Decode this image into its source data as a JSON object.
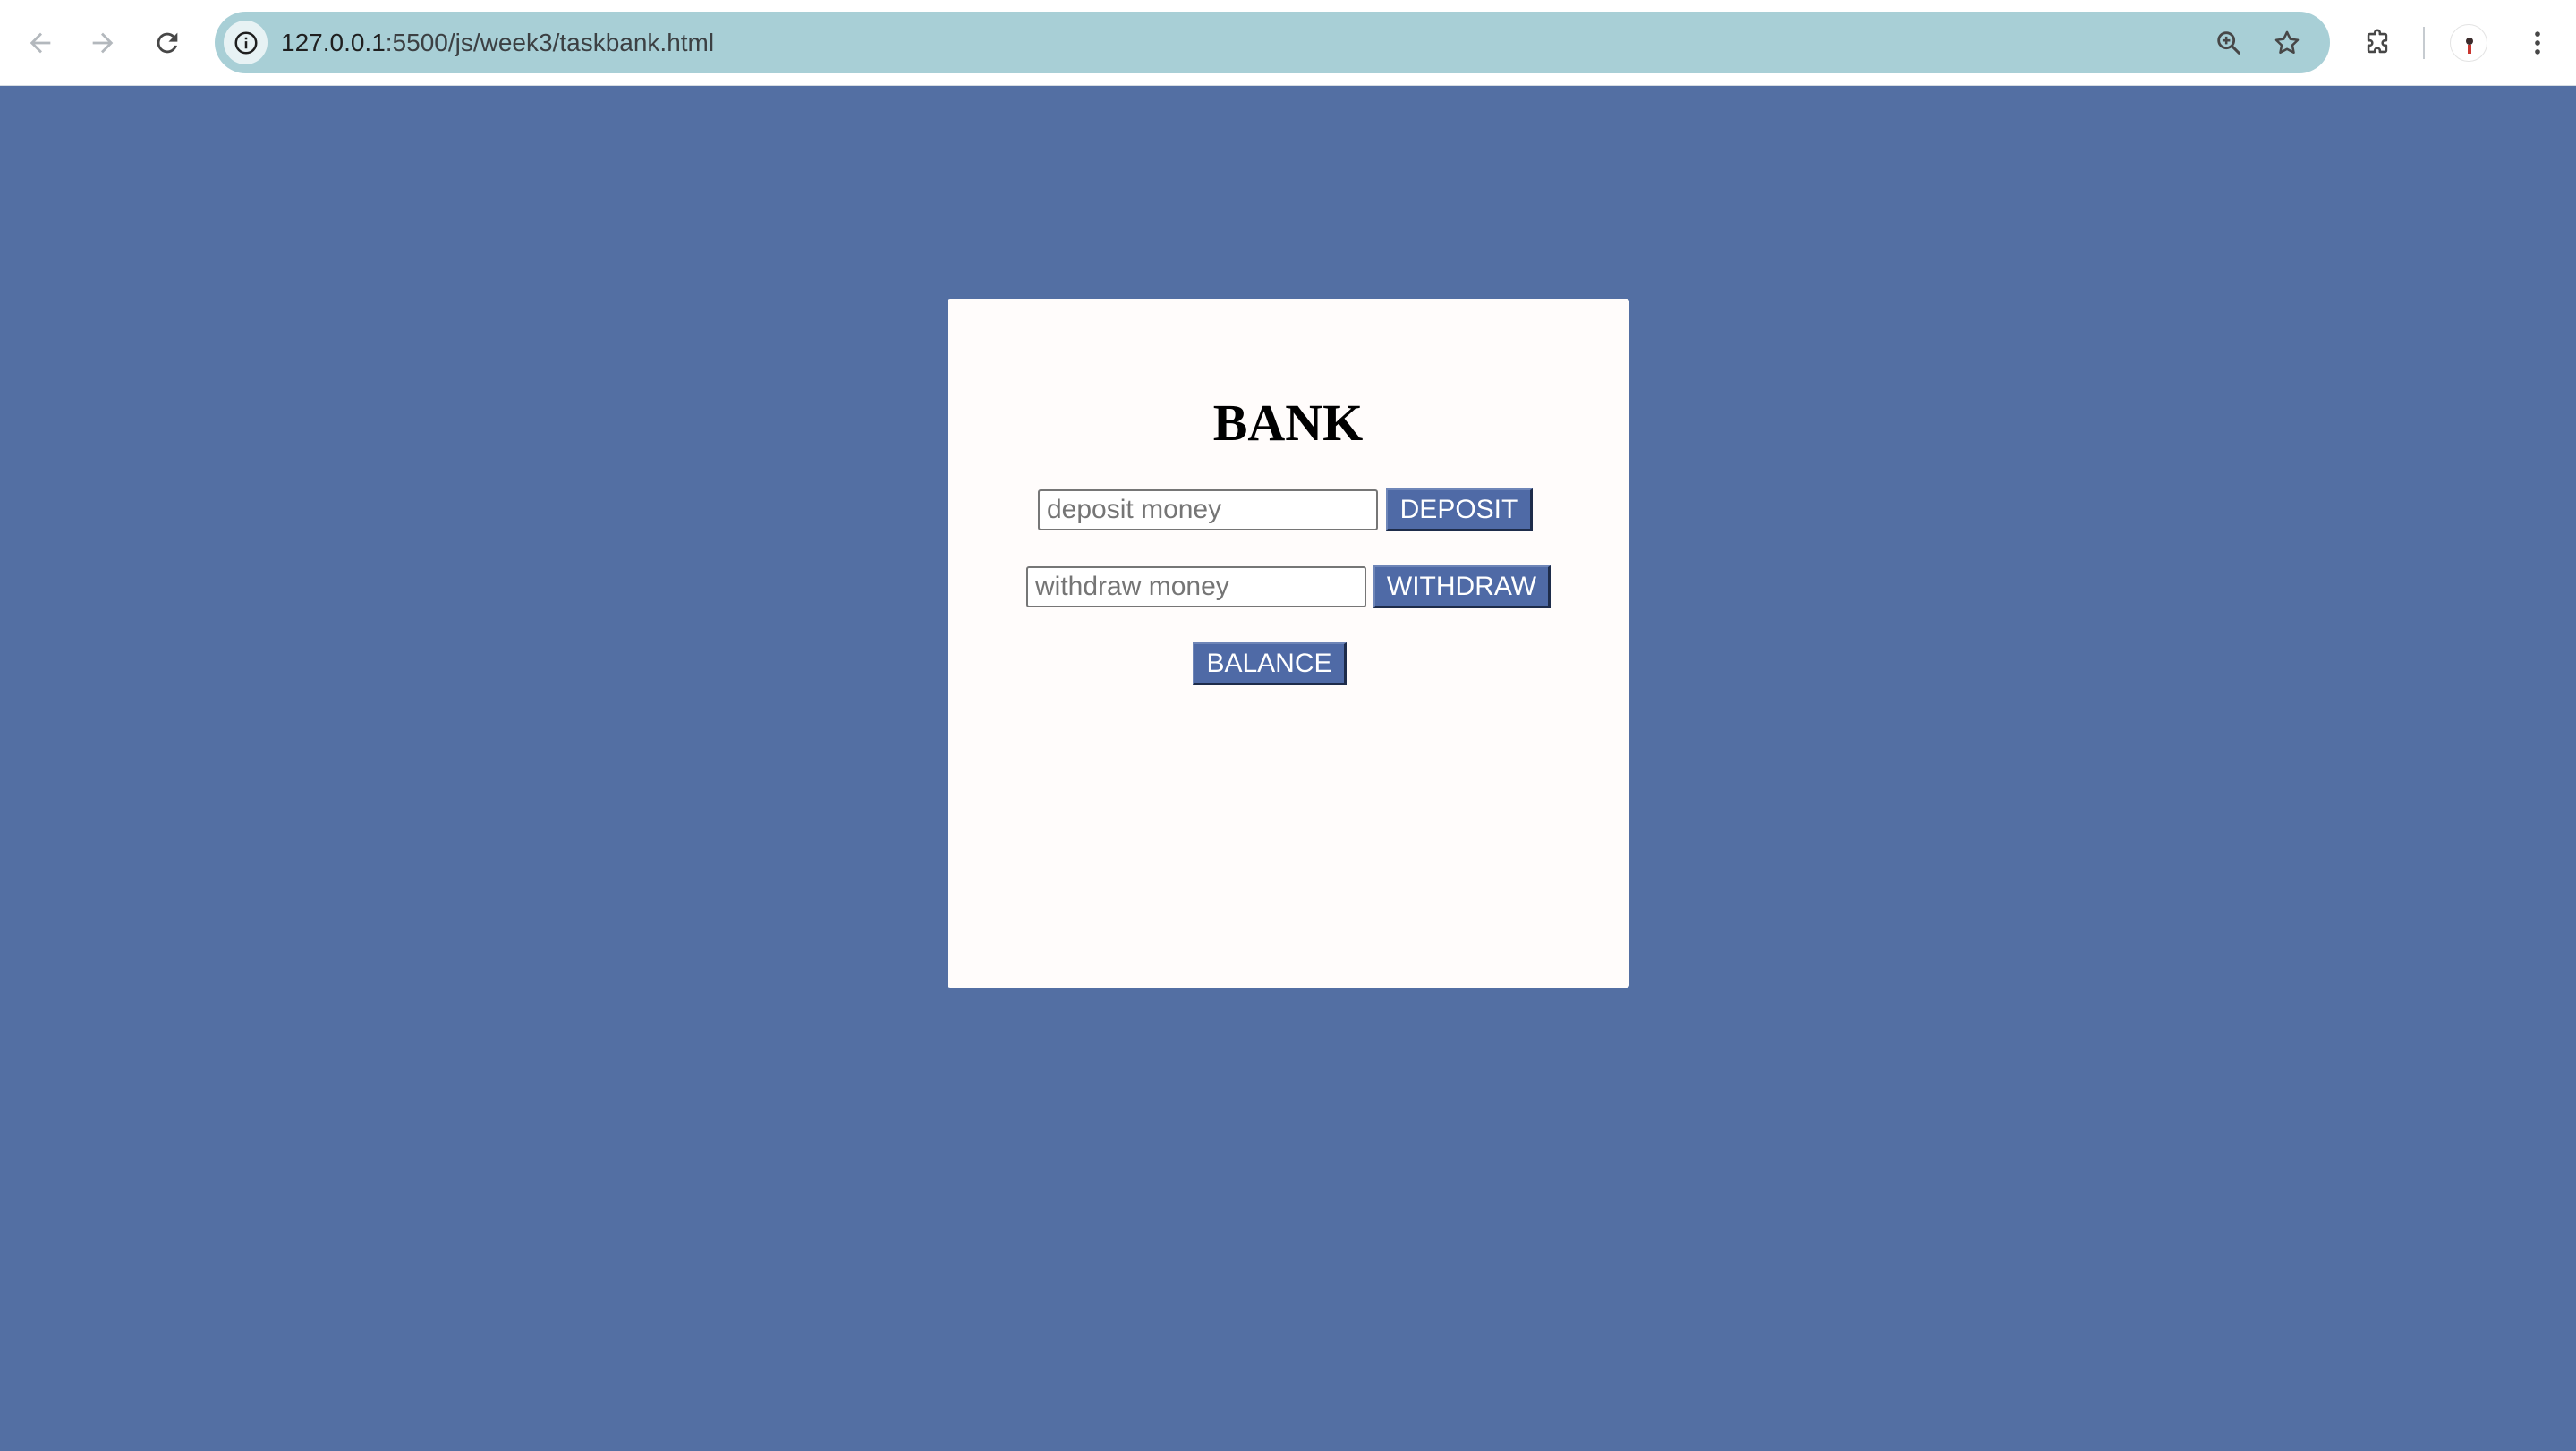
{
  "browser": {
    "url_host": "127.0.0.1",
    "url_path": ":5500/js/week3/taskbank.html",
    "icons": {
      "back": "back-arrow-icon",
      "forward": "forward-arrow-icon",
      "reload": "reload-icon",
      "site_info": "info-icon",
      "zoom": "zoom-icon",
      "bookmark": "star-icon",
      "extensions": "puzzle-icon",
      "menu": "more-vert-icon"
    },
    "colors": {
      "omnibox": "#a8cfd6",
      "toolbar": "#ffffff"
    }
  },
  "page": {
    "background": "#536fa3",
    "title": "BANK",
    "deposit": {
      "placeholder": "deposit money",
      "value": "",
      "button_label": "DEPOSIT"
    },
    "withdraw": {
      "placeholder": "withdraw money",
      "value": "",
      "button_label": "WITHDRAW"
    },
    "balance": {
      "button_label": "BALANCE"
    },
    "colors": {
      "button": "#4f6aa6",
      "card": "#fffcfb"
    }
  }
}
